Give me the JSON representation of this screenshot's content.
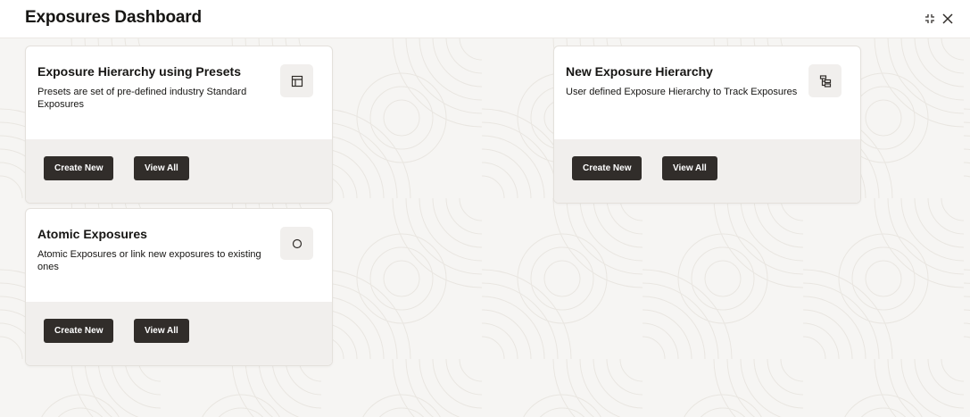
{
  "header": {
    "title": "Exposures Dashboard"
  },
  "cards": [
    {
      "title": "Exposure Hierarchy using Presets",
      "description": "Presets are set of pre-defined industry Standard Exposures",
      "icon": "layout-panels-icon",
      "create_label": "Create New",
      "view_label": "View All"
    },
    {
      "title": "New Exposure Hierarchy",
      "description": "User defined Exposure Hierarchy to Track Exposures",
      "icon": "hierarchy-tree-icon",
      "create_label": "Create New",
      "view_label": "View All"
    },
    {
      "title": "Atomic Exposures",
      "description": "Atomic Exposures or link new exposures to existing ones",
      "icon": "circle-icon",
      "create_label": "Create New",
      "view_label": "View All"
    }
  ]
}
